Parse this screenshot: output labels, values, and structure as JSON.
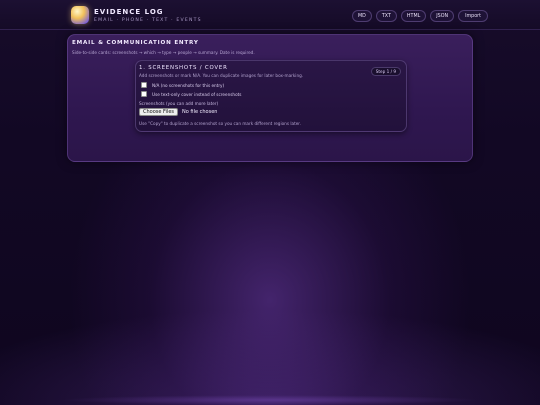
{
  "header": {
    "title": "EVIDENCE LOG",
    "subtitle": "EMAIL · PHONE · TEXT · EVENTS",
    "buttons": [
      "MD",
      "TXT",
      "HTML",
      "JSON",
      "Import"
    ]
  },
  "entry": {
    "title": "EMAIL & COMMUNICATION ENTRY",
    "subtitle": "Side-to-side cards: screenshots → which → type → people → summary. Date is required."
  },
  "step_card": {
    "title": "1. SCREENSHOTS / COVER",
    "step": "Step 1 / 9",
    "description": "Add screenshots or mark N/A. You can duplicate images for later box-marking.",
    "options": [
      {
        "label": "N/A (no screenshots for this entry)",
        "checked": false
      },
      {
        "label": "Use text-only cover instead of screenshots",
        "checked": false
      }
    ],
    "file_label": "Screenshots (you can add more later)",
    "file_button": "Choose Files",
    "file_status": "No file chosen",
    "hint": "Use \"Copy\" to duplicate a screenshot so you can mark different regions later."
  },
  "colors": {
    "background": "#120824",
    "panel": "#3a1f5c",
    "card": "#2a1646",
    "accent": "#7a5fd6"
  }
}
